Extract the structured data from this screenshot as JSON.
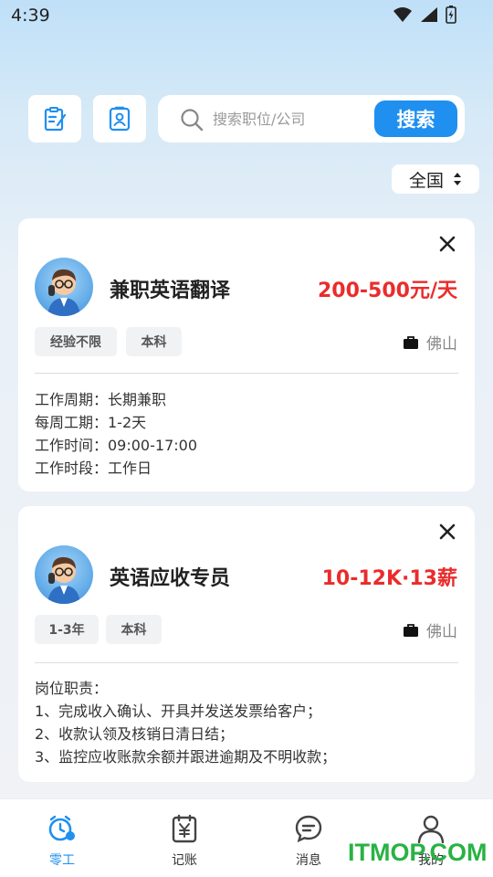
{
  "status_bar": {
    "time": "4:39"
  },
  "toolbar": {
    "search": {
      "placeholder": "搜索职位/公司",
      "button_label": "搜索"
    },
    "region": {
      "selected": "全国"
    }
  },
  "jobs": [
    {
      "title": "兼职英语翻译",
      "salary": "200-500元/天",
      "tags": [
        "经验不限",
        "本科"
      ],
      "location": "佛山",
      "details": [
        "工作周期：长期兼职",
        "每周工期：1-2天",
        "工作时间：09:00-17:00",
        "工作时段：工作日"
      ]
    },
    {
      "title": "英语应收专员",
      "salary": "10-12K·13薪",
      "tags": [
        "1-3年",
        "本科"
      ],
      "location": "佛山",
      "details": [
        "岗位职责：",
        "1、完成收入确认、开具并发送发票给客户；",
        "2、收款认领及核销日清日结；",
        "3、监控应收账款余额并跟进逾期及不明收款；"
      ]
    }
  ],
  "tab_bar": {
    "tabs": [
      {
        "label": "零工",
        "icon": "odd-job-clock-icon",
        "active": true
      },
      {
        "label": "记账",
        "icon": "ledger-yuan-icon",
        "active": false
      },
      {
        "label": "消息",
        "icon": "message-bubble-icon",
        "active": false
      },
      {
        "label": "我的",
        "icon": "profile-person-icon",
        "active": false
      }
    ]
  },
  "watermark": "ITMOP.COM",
  "colors": {
    "accent": "#1f8ff0",
    "salary": "#ea2c2c",
    "watermark": "#29b244"
  }
}
